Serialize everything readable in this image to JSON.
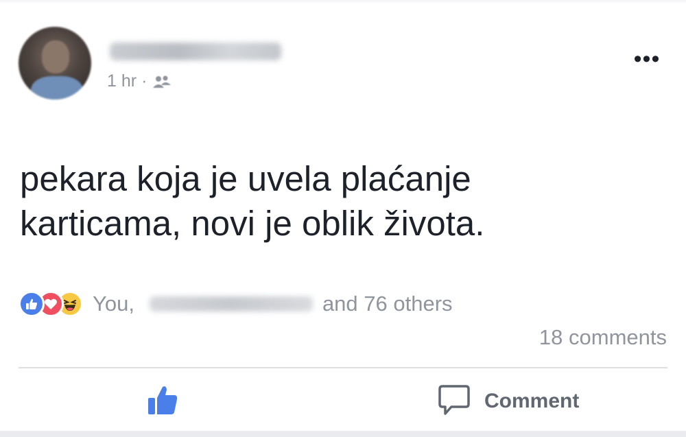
{
  "post": {
    "meta": {
      "time": "1 hr",
      "separator": "·",
      "privacy_icon": "friends-icon"
    },
    "more_label": "•••",
    "text_lines": [
      "pekara koja je uvela plaćanje",
      "karticama, novi je oblik života."
    ],
    "reactions": {
      "icons": [
        "like-reaction-icon",
        "love-reaction-icon",
        "haha-reaction-icon"
      ],
      "you_label": "You,",
      "others_label": "and 76 others"
    },
    "comments_label": "18 comments",
    "actions": {
      "like_icon": "thumbs-up-icon",
      "comment_icon": "speech-bubble-icon",
      "comment_label": "Comment"
    }
  },
  "colors": {
    "text": "#1d2129",
    "secondary": "#90949c",
    "like_blue": "#4a7ee8",
    "love_red": "#ef4f5e",
    "haha_yellow": "#f7c844",
    "action_gray": "#606770",
    "divider": "#dddfe2"
  }
}
